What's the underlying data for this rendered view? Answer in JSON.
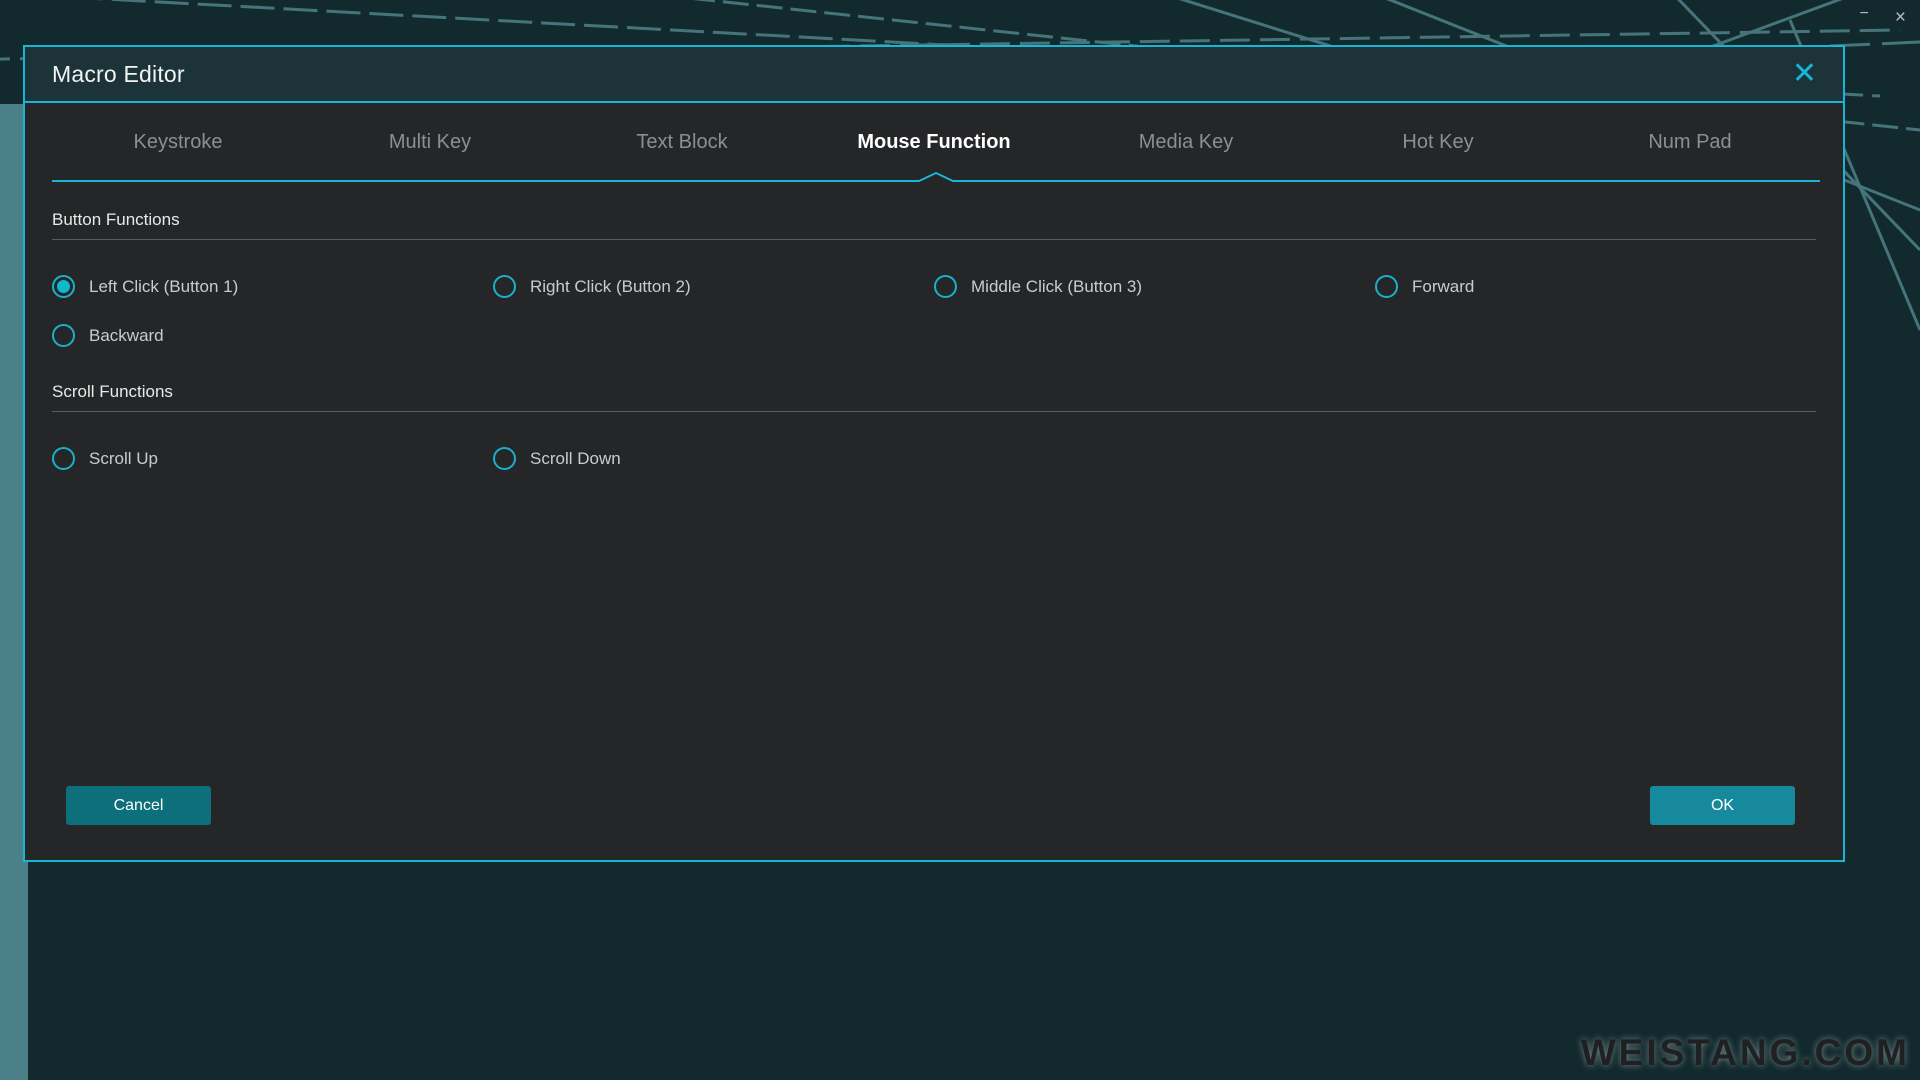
{
  "window": {
    "minimize_label": "−",
    "close_label": "×"
  },
  "dialog": {
    "title": "Macro Editor",
    "close_label": "✕"
  },
  "tabs": [
    {
      "label": "Keystroke",
      "active": false
    },
    {
      "label": "Multi Key",
      "active": false
    },
    {
      "label": "Text Block",
      "active": false
    },
    {
      "label": "Mouse Function",
      "active": true
    },
    {
      "label": "Media Key",
      "active": false
    },
    {
      "label": "Hot Key",
      "active": false
    },
    {
      "label": "Num Pad",
      "active": false
    }
  ],
  "sections": [
    {
      "title": "Button Functions",
      "options": [
        {
          "label": "Left Click (Button 1)",
          "checked": true
        },
        {
          "label": "Right Click (Button 2)",
          "checked": false
        },
        {
          "label": "Middle Click (Button 3)",
          "checked": false
        },
        {
          "label": "Forward",
          "checked": false
        },
        {
          "label": "Backward",
          "checked": false
        }
      ]
    },
    {
      "title": "Scroll Functions",
      "options": [
        {
          "label": "Scroll Up",
          "checked": false
        },
        {
          "label": "Scroll Down",
          "checked": false
        }
      ]
    }
  ],
  "footer": {
    "cancel_label": "Cancel",
    "ok_label": "OK"
  },
  "watermark": "WEISTANG.COM",
  "colors": {
    "accent": "#18b6d6",
    "radio_ring": "#1ab0cc",
    "radio_dot": "#0eb8cf",
    "dialog_bg": "#252628",
    "header_bg": "#1c3439",
    "desktop_bg": "#122a2e",
    "cancel_bg": "#0d6e7c",
    "ok_bg": "#17899c",
    "sidebar_strip": "#4c8089"
  }
}
